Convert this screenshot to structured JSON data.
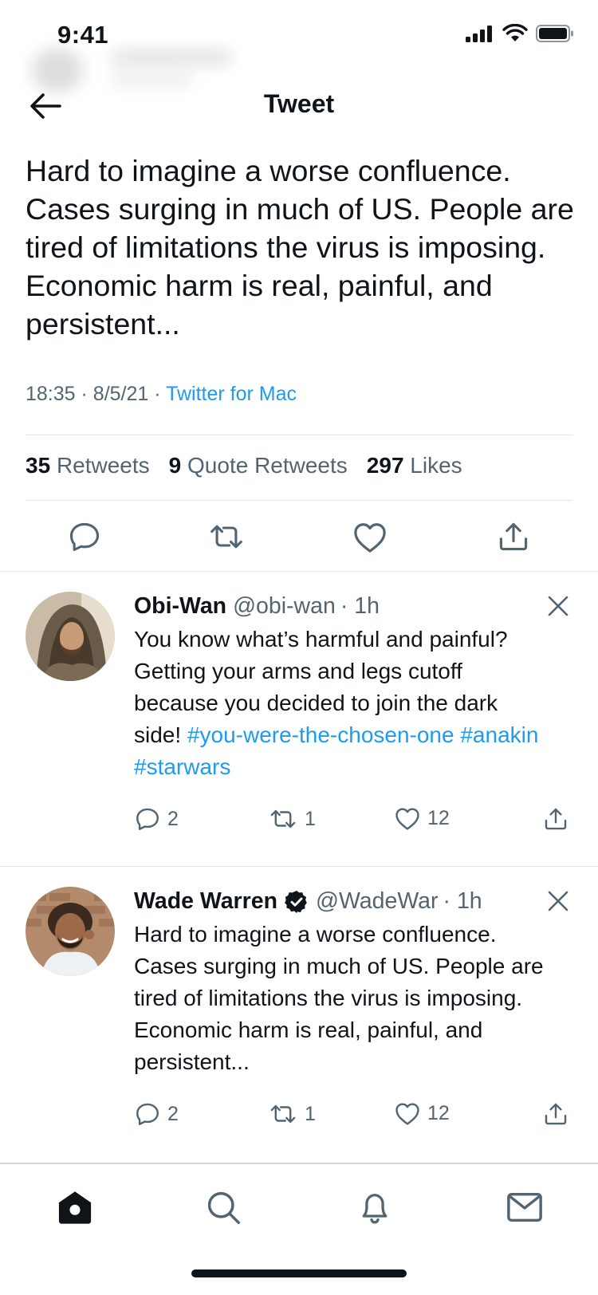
{
  "status_bar": {
    "time": "9:41"
  },
  "header": {
    "title": "Tweet"
  },
  "main_tweet": {
    "text": "Hard to imagine a worse confluence. Cases surging in much of US. People are tired of limitations the virus is imposing. Economic harm is real, painful, and persistent...",
    "time": "18:35",
    "date": "8/5/21",
    "separator": "·",
    "source": "Twitter for Mac",
    "stats": {
      "retweets_count": "35",
      "retweets_label": "Retweets",
      "quote_count": "9",
      "quote_label": "Quote Retweets",
      "likes_count": "297",
      "likes_label": "Likes"
    }
  },
  "replies": [
    {
      "name": "Obi-Wan",
      "handle": "@obi-wan",
      "time": "· 1h",
      "text": "You know what’s harmful and painful? Getting your arms and legs cutoff because you decided to join the dark side! ",
      "hashtags": [
        "#you-were-the-chosen-one",
        "#anakin",
        "#starwars"
      ],
      "reply_count": "2",
      "retweet_count": "1",
      "like_count": "12",
      "verified": false
    },
    {
      "name": "Wade Warren",
      "handle": "@WadeWar",
      "time": "· 1h",
      "text": "Hard to imagine a worse confluence. Cases surging in much of US. People are tired of limitations the virus is imposing. Economic harm is real, painful, and persistent...",
      "reply_count": "2",
      "retweet_count": "1",
      "like_count": "12",
      "verified": true
    }
  ],
  "icons": {
    "back": "arrow-left-icon",
    "reply": "speech-bubble-icon",
    "retweet": "retweet-icon",
    "like": "heart-icon",
    "share": "share-icon",
    "close": "close-icon",
    "tabs": [
      "home-icon",
      "search-icon",
      "bell-icon",
      "mail-icon"
    ]
  },
  "colors": {
    "accent": "#1d9bf0",
    "text": "#0f1419",
    "secondary": "#536471",
    "divider": "#e1e6ea"
  }
}
